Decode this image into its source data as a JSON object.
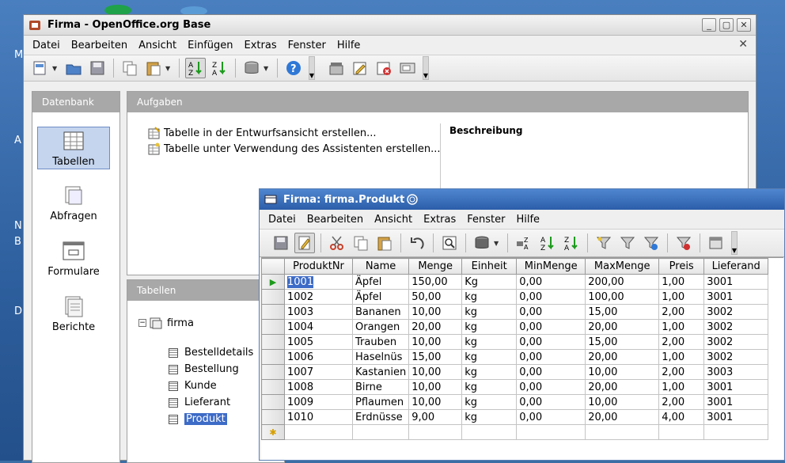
{
  "desktop": {
    "labels": [
      "M",
      "A",
      "N",
      "B",
      "D"
    ]
  },
  "main_window": {
    "title": "Firma - OpenOffice.org Base",
    "window_buttons": [
      "_",
      "▢",
      "✕"
    ],
    "menu": [
      "Datei",
      "Bearbeiten",
      "Ansicht",
      "Einfügen",
      "Extras",
      "Fenster",
      "Hilfe"
    ],
    "menu_close": "✕"
  },
  "left_panel": {
    "header": "Datenbank",
    "items": [
      {
        "label": "Tabellen",
        "icon": "table-icon",
        "selected": true
      },
      {
        "label": "Abfragen",
        "icon": "query-icon",
        "selected": false
      },
      {
        "label": "Formulare",
        "icon": "form-icon",
        "selected": false
      },
      {
        "label": "Berichte",
        "icon": "report-icon",
        "selected": false
      }
    ]
  },
  "tasks_panel": {
    "header": "Aufgaben",
    "tasks": [
      "Tabelle in der Entwurfsansicht erstellen...",
      "Tabelle unter Verwendung des Assistenten erstellen..."
    ],
    "description_label": "Beschreibung"
  },
  "tables_panel": {
    "header": "Tabellen",
    "root": "firma",
    "tables": [
      "Bestelldetails",
      "Bestellung",
      "Kunde",
      "Lieferant",
      "Produkt"
    ],
    "selected": "Produkt"
  },
  "child_window": {
    "title": "Firma: firma.Produkt",
    "menu": [
      "Datei",
      "Bearbeiten",
      "Ansicht",
      "Extras",
      "Fenster",
      "Hilfe"
    ],
    "columns": [
      "ProduktNr",
      "Name",
      "Menge",
      "Einheit",
      "MinMenge",
      "MaxMenge",
      "Preis",
      "Lieferand"
    ],
    "rows": [
      [
        "1001",
        "Äpfel",
        "150,00",
        "Kg",
        "0,00",
        "200,00",
        "1,00",
        "3001"
      ],
      [
        "1002",
        "Äpfel",
        "50,00",
        "kg",
        "0,00",
        "100,00",
        "1,00",
        "3001"
      ],
      [
        "1003",
        "Bananen",
        "10,00",
        "kg",
        "0,00",
        "15,00",
        "2,00",
        "3002"
      ],
      [
        "1004",
        "Orangen",
        "20,00",
        "kg",
        "0,00",
        "20,00",
        "1,00",
        "3002"
      ],
      [
        "1005",
        "Trauben",
        "10,00",
        "kg",
        "0,00",
        "15,00",
        "2,00",
        "3002"
      ],
      [
        "1006",
        "Haselnüs",
        "15,00",
        "kg",
        "0,00",
        "20,00",
        "1,00",
        "3002"
      ],
      [
        "1007",
        "Kastanien",
        "10,00",
        "kg",
        "0,00",
        "10,00",
        "2,00",
        "3003"
      ],
      [
        "1008",
        "Birne",
        "10,00",
        "kg",
        "0,00",
        "20,00",
        "1,00",
        "3001"
      ],
      [
        "1009",
        "Pflaumen",
        "10,00",
        "kg",
        "0,00",
        "10,00",
        "2,00",
        "3001"
      ],
      [
        "1010",
        "Erdnüsse",
        "9,00",
        "kg",
        "0,00",
        "20,00",
        "4,00",
        "3001"
      ]
    ],
    "current_row_marker": "▶",
    "new_row_marker": "✱"
  }
}
